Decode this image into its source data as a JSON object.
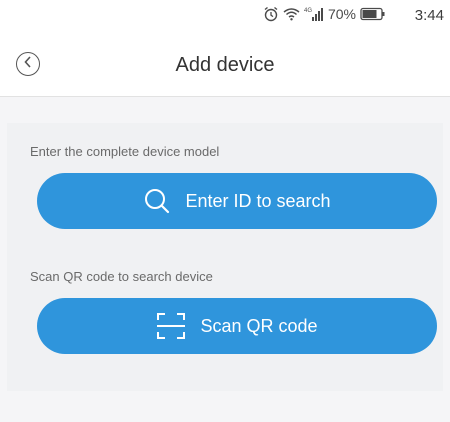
{
  "status_bar": {
    "battery_percent": "70%",
    "time": "3:44",
    "icons": [
      "alarm-icon",
      "wifi-icon",
      "signal-4g-icon",
      "battery-icon"
    ]
  },
  "header": {
    "title": "Add device",
    "back_icon": "back-icon"
  },
  "id_search": {
    "label": "Enter the complete device model",
    "button_label": "Enter ID to search",
    "icon": "search-icon"
  },
  "qr_search": {
    "label": "Scan QR code to search device",
    "button_label": "Scan QR code",
    "icon": "scan-qr-icon"
  },
  "colors": {
    "accent": "#2f95dc",
    "background": "#f5f5f7"
  }
}
